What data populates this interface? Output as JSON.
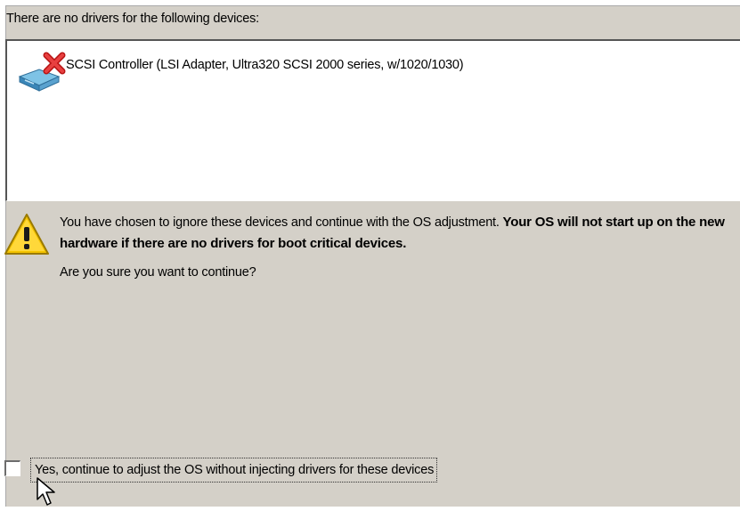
{
  "heading": "There are no drivers for the following devices:",
  "devices": [
    {
      "label": "SCSI Controller (LSI Adapter, Ultra320 SCSI 2000 series, w/1020/1030)",
      "icon": "scsi-controller-error-icon"
    }
  ],
  "warning": {
    "icon": "warning-icon",
    "text_normal": "You have chosen to ignore these devices and continue with the OS adjustment. ",
    "text_bold": "Your OS will not start up on the new hardware if there are no drivers for boot critical devices.",
    "question": "Are you sure you want to continue?"
  },
  "confirm": {
    "label": "Yes, continue to adjust the OS without injecting drivers for these devices",
    "checked": false
  },
  "colors": {
    "panel_bg": "#d4d0c8",
    "list_bg": "#ffffff",
    "error_red": "#d42020",
    "warning_yellow": "#f5c400"
  }
}
